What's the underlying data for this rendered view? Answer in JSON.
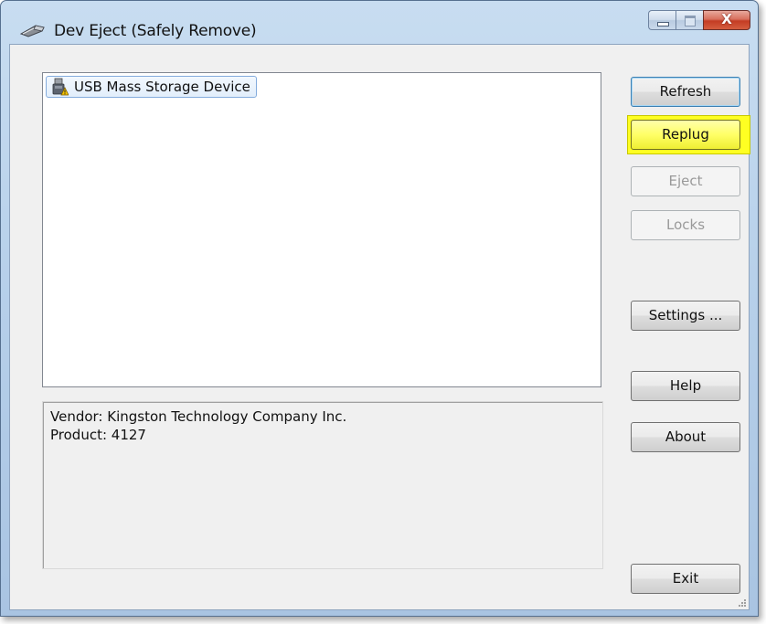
{
  "window": {
    "title": "Dev Eject (Safely Remove)",
    "icon": "usb-drive-icon",
    "controls": {
      "minimize": "minimize-icon",
      "maximize": "maximize-icon",
      "close_glyph": "X"
    }
  },
  "device_list": {
    "items": [
      {
        "label": "USB Mass Storage Device",
        "icon": "usb-device-warning-icon",
        "selected": true
      }
    ]
  },
  "info": {
    "vendor_line": "Vendor: Kingston Technology Company Inc.",
    "product_line": "Product: 4127"
  },
  "buttons": {
    "refresh": "Refresh",
    "replug": "Replug",
    "eject": "Eject",
    "locks": "Locks",
    "settings": "Settings ...",
    "help": "Help",
    "about": "About",
    "exit": "Exit"
  },
  "colors": {
    "highlight": "#ffff22",
    "titlebar": "#b9d1ea",
    "close_button": "#c8432b"
  }
}
